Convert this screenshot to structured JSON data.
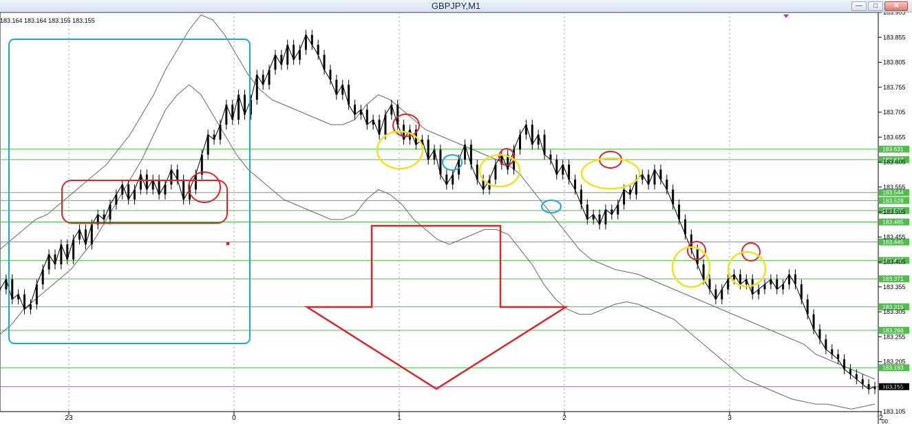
{
  "window": {
    "title": "GBPJPY,M1",
    "controls": {
      "minimize": "—",
      "restore": "□",
      "close": "✕"
    }
  },
  "status": {
    "ohlc_readout": "183.164 183.164 183.155 183.155"
  },
  "chart_data": {
    "type": "line",
    "symbol": "GBPJPY",
    "timeframe": "M1",
    "ylim": [
      183.105,
      183.905
    ],
    "y_ticks": [
      "183.905",
      "183.855",
      "183.805",
      "183.755",
      "183.705",
      "183.655",
      "183.605",
      "183.555",
      "183.505",
      "183.455",
      "183.405",
      "183.355",
      "183.305",
      "183.255",
      "183.205",
      "183.155",
      "183.105"
    ],
    "x_ticks": [
      {
        "label": "23"
      },
      {
        "label": "0"
      },
      {
        "label": "1"
      },
      {
        "label": "2"
      },
      {
        "label": "3"
      },
      {
        "label": "2"
      }
    ],
    "x_corner_label": "00",
    "horizontal_levels": [
      {
        "value": 183.631,
        "label": "183.631"
      },
      {
        "value": 183.61,
        "label": "183.610"
      },
      {
        "value": 183.544,
        "label": "183.544"
      },
      {
        "value": 183.528,
        "label": "183.528"
      },
      {
        "value": 183.508,
        "label": "183.508"
      },
      {
        "value": 183.485,
        "label": "183.485"
      },
      {
        "value": 183.445,
        "label": "183.445"
      },
      {
        "value": 183.408,
        "label": "183.408"
      },
      {
        "value": 183.371,
        "label": "183.371"
      },
      {
        "value": 183.315,
        "label": "183.315"
      },
      {
        "value": 183.268,
        "label": "183.268"
      },
      {
        "value": 183.193,
        "label": "183.193"
      }
    ],
    "current_price": {
      "value": 183.155,
      "label": "183.155"
    },
    "series": [
      {
        "values": [
          183.35,
          183.37,
          183.33,
          183.34,
          183.31,
          183.32,
          183.36,
          183.39,
          183.42,
          183.4,
          183.44,
          183.41,
          183.45,
          183.47,
          183.44,
          183.48,
          183.5,
          183.49,
          183.52,
          183.54,
          183.56,
          183.53,
          183.55,
          183.58,
          183.55,
          183.57,
          183.54,
          183.56,
          183.59,
          183.57,
          183.53,
          183.55,
          183.58,
          183.62,
          183.66,
          183.65,
          183.68,
          183.72,
          183.69,
          183.74,
          183.7,
          183.73,
          183.78,
          183.76,
          183.79,
          183.82,
          183.8,
          183.84,
          183.81,
          183.83,
          183.86,
          183.84,
          183.82,
          183.79,
          183.77,
          183.74,
          183.76,
          183.72,
          183.7,
          183.71,
          183.68,
          183.69,
          183.66,
          183.7,
          183.72,
          183.68,
          183.65,
          183.67,
          183.64,
          183.65,
          183.61,
          183.63,
          183.58,
          183.56,
          183.58,
          183.61,
          183.64,
          183.6,
          183.57,
          183.55,
          183.57,
          183.6,
          183.62,
          183.59,
          183.63,
          183.66,
          183.68,
          183.64,
          183.66,
          183.62,
          183.61,
          183.58,
          183.6,
          183.57,
          183.55,
          183.52,
          183.49,
          183.5,
          183.48,
          183.51,
          183.5,
          183.52,
          183.55,
          183.54,
          183.57,
          183.58,
          183.56,
          183.59,
          183.57,
          183.55,
          183.52,
          183.49,
          183.46,
          183.43,
          183.4,
          183.37,
          183.35,
          183.33,
          183.35,
          183.37,
          183.38,
          183.36,
          183.37,
          183.34,
          183.35,
          183.36,
          183.37,
          183.35,
          183.36,
          183.38,
          183.36,
          183.33,
          183.3,
          183.27,
          183.25,
          183.23,
          183.22,
          183.21,
          183.19,
          183.18,
          183.17,
          183.16,
          183.15,
          183.155
        ]
      },
      {
        "values": [
          183.43,
          183.45,
          183.47,
          183.49,
          183.5,
          183.52,
          183.54,
          183.56,
          183.58,
          183.6,
          183.63,
          183.66,
          183.7,
          183.74,
          183.79,
          183.83,
          183.87,
          183.9,
          183.89,
          183.86,
          183.82,
          183.78,
          183.75,
          183.73,
          183.72,
          183.71,
          183.7,
          183.69,
          183.68,
          183.68,
          183.69,
          183.72,
          183.74,
          183.73,
          183.71,
          183.69,
          183.67,
          183.66,
          183.65,
          183.64,
          183.63,
          183.62,
          183.61,
          183.6,
          183.58,
          183.55,
          183.52,
          183.49,
          183.46,
          183.43,
          183.41,
          183.4,
          183.39,
          183.385,
          183.38,
          183.37,
          183.36,
          183.35,
          183.34,
          183.33,
          183.32,
          183.31,
          183.3,
          183.29,
          183.28,
          183.27,
          183.26,
          183.25,
          183.24,
          183.22,
          183.21,
          183.2,
          183.19,
          183.18,
          183.17
        ]
      },
      {
        "values": [
          183.26,
          183.28,
          183.31,
          183.33,
          183.35,
          183.37,
          183.39,
          183.42,
          183.45,
          183.49,
          183.53,
          183.57,
          183.61,
          183.66,
          183.71,
          183.74,
          183.76,
          183.74,
          183.7,
          183.66,
          183.62,
          183.59,
          183.57,
          183.55,
          183.53,
          183.52,
          183.51,
          183.5,
          183.49,
          183.49,
          183.5,
          183.53,
          183.55,
          183.54,
          183.52,
          183.49,
          183.47,
          183.45,
          183.44,
          183.45,
          183.46,
          183.47,
          183.47,
          183.46,
          183.43,
          183.4,
          183.36,
          183.33,
          183.31,
          183.3,
          183.3,
          183.31,
          183.32,
          183.325,
          183.32,
          183.31,
          183.3,
          183.29,
          183.27,
          183.25,
          183.23,
          183.21,
          183.19,
          183.17,
          183.16,
          183.15,
          183.14,
          183.13,
          183.125,
          183.12,
          183.12,
          183.115,
          183.11,
          183.115,
          183.12
        ]
      }
    ]
  }
}
